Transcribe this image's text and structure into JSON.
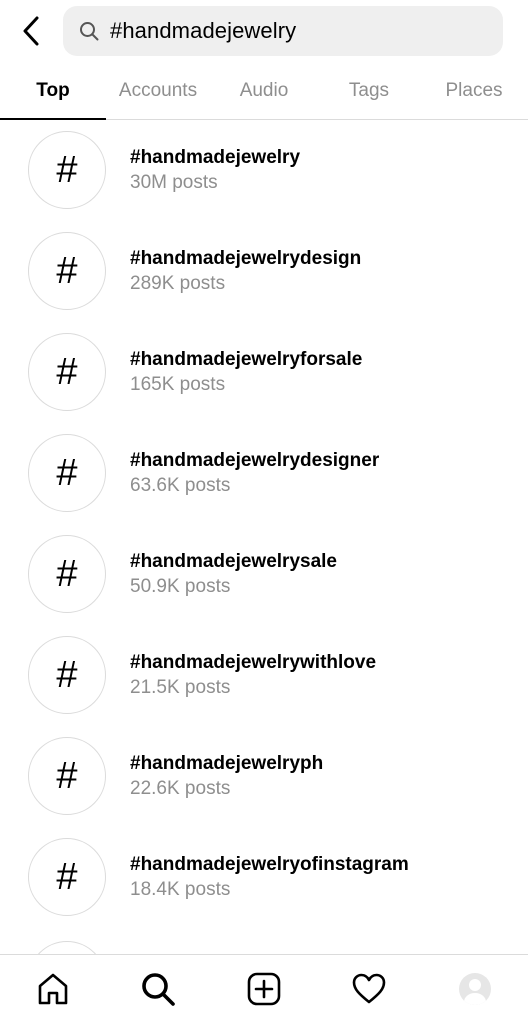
{
  "search": {
    "query": "#handmadejewelry"
  },
  "tabs": [
    {
      "label": "Top",
      "active": true
    },
    {
      "label": "Accounts",
      "active": false
    },
    {
      "label": "Audio",
      "active": false
    },
    {
      "label": "Tags",
      "active": false
    },
    {
      "label": "Places",
      "active": false
    }
  ],
  "results": [
    {
      "icon": "#",
      "title": "#handmadejewelry",
      "count": "30M posts"
    },
    {
      "icon": "#",
      "title": "#handmadejewelrydesign",
      "count": "289K posts"
    },
    {
      "icon": "#",
      "title": "#handmadejewelryforsale",
      "count": "165K posts"
    },
    {
      "icon": "#",
      "title": "#handmadejewelrydesigner",
      "count": "63.6K posts"
    },
    {
      "icon": "#",
      "title": "#handmadejewelrysale",
      "count": "50.9K posts"
    },
    {
      "icon": "#",
      "title": "#handmadejewelrywithlove",
      "count": "21.5K posts"
    },
    {
      "icon": "#",
      "title": "#handmadejewelryph",
      "count": "22.6K posts"
    },
    {
      "icon": "#",
      "title": "#handmadejewelryofinstagram",
      "count": "18.4K posts"
    }
  ],
  "nav": [
    {
      "icon": "home-icon"
    },
    {
      "icon": "search-icon"
    },
    {
      "icon": "create-icon"
    },
    {
      "icon": "heart-icon"
    },
    {
      "icon": "profile-avatar"
    }
  ]
}
